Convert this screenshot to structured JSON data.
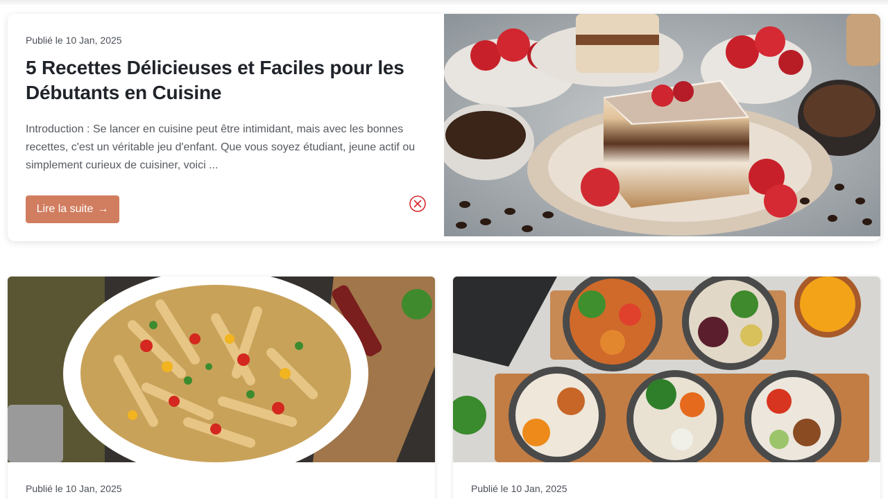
{
  "featured": {
    "date": "Publié le 10 Jan, 2025",
    "title": "5 Recettes Délicieuses et Faciles pour les Débutants en Cuisine",
    "excerpt": "Introduction : Se lancer en cuisine peut être intimidant, mais avec les bonnes recettes, c'est un véritable jeu d'enfant. Que vous soyez étudiant, jeune actif ou simplement curieux de cuisiner, voici ...",
    "button_label": "Lire la suite",
    "button_arrow": "→",
    "close_icon": "close-circle-icon",
    "image": "tiramisu-strawberries-photo"
  },
  "cards": [
    {
      "date": "Publié le 10 Jan, 2025",
      "image": "penne-pasta-vegetables-photo"
    },
    {
      "date": "Publié le 10 Jan, 2025",
      "image": "buddha-bowls-photo"
    }
  ],
  "colors": {
    "accent": "#d17d5f",
    "close_icon": "#d9262a",
    "title": "#20242a",
    "body": "#55595f"
  }
}
